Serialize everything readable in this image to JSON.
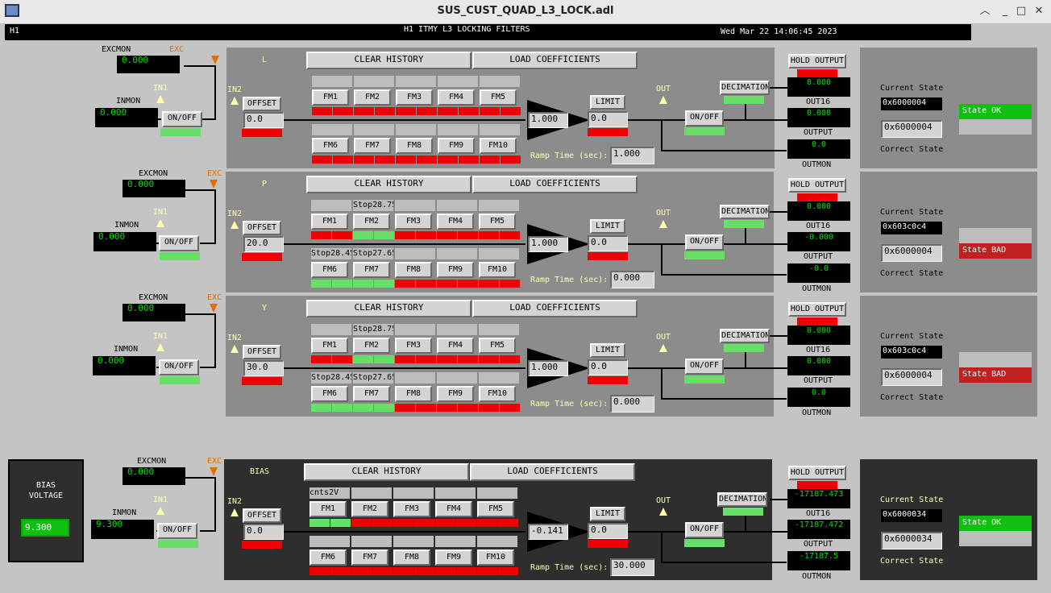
{
  "window": {
    "title": "SUS_CUST_QUAD_L3_LOCK.adl"
  },
  "header": {
    "site": "H1",
    "title": "H1 ITMY L3 LOCKING FILTERS",
    "datetime": "Wed Mar 22 14:06:45 2023"
  },
  "common": {
    "excmon": "EXCMON",
    "exc": "EXC",
    "in1": "IN1",
    "inmon": "INMON",
    "in2": "IN2",
    "onoff": "ON/OFF",
    "offset": "OFFSET",
    "clear_history": "CLEAR HISTORY",
    "load_coefficients": "LOAD COEFFICIENTS",
    "limit": "LIMIT",
    "out": "OUT",
    "ramp_time": "Ramp Time (sec):",
    "hold_output": "HOLD OUTPUT",
    "decimation": "DECIMATION",
    "out16": "OUT16",
    "output": "OUTPUT",
    "outmon": "OUTMON",
    "current_state": "Current State",
    "correct_state": "Correct State",
    "fm_labels": [
      "FM1",
      "FM2",
      "FM3",
      "FM4",
      "FM5",
      "FM6",
      "FM7",
      "FM8",
      "FM9",
      "FM10"
    ]
  },
  "banks": [
    {
      "name": "L",
      "excmon": "0.000",
      "inmon": "0.000",
      "offset": "0.0",
      "gain": "1.000",
      "limit": "0.0",
      "ramp": "1.000",
      "out16": "0.000",
      "output": "0.000",
      "outmon": "0.0",
      "current_state": "0x6000004",
      "correct_state": "0x6000004",
      "state_text": "State OK",
      "state_ok": true,
      "fm_names": [
        "",
        "",
        "",
        "",
        "",
        "",
        "",
        "",
        "",
        ""
      ],
      "fm_on": [
        false,
        false,
        false,
        false,
        false,
        false,
        false,
        false,
        false,
        false
      ]
    },
    {
      "name": "P",
      "excmon": "0.000",
      "inmon": "0.000",
      "offset": "20.0",
      "gain": "1.000",
      "limit": "0.0",
      "ramp": "0.000",
      "out16": "0.000",
      "output": "-0.000",
      "outmon": "-0.0",
      "current_state": "0x603c0c4",
      "correct_state": "0x6000004",
      "state_text": "State BAD",
      "state_ok": false,
      "fm_names": [
        "",
        "Stop28.75",
        "",
        "",
        "",
        "Stop28.45",
        "Stop27.65",
        "",
        "",
        ""
      ],
      "fm_on": [
        false,
        true,
        false,
        false,
        false,
        true,
        true,
        false,
        false,
        false
      ]
    },
    {
      "name": "Y",
      "excmon": "0.000",
      "inmon": "0.000",
      "offset": "30.0",
      "gain": "1.000",
      "limit": "0.0",
      "ramp": "0.000",
      "out16": "0.000",
      "output": "0.000",
      "outmon": "0.0",
      "current_state": "0x603c0c4",
      "correct_state": "0x6000004",
      "state_text": "State BAD",
      "state_ok": false,
      "fm_names": [
        "",
        "Stop28.75",
        "",
        "",
        "",
        "Stop28.45",
        "Stop27.65",
        "",
        "",
        ""
      ],
      "fm_on": [
        false,
        true,
        false,
        false,
        false,
        true,
        true,
        false,
        false,
        false
      ]
    },
    {
      "name": "BIAS",
      "excmon": "0.000",
      "inmon": "9.300",
      "offset": "0.0",
      "gain": "-0.141",
      "limit": "0.0",
      "ramp": "30.000",
      "out16": "-17187.473",
      "output": "-17187.472",
      "outmon": "-17187.5",
      "current_state": "0x6000034",
      "correct_state": "0x6000034",
      "state_text": "State OK",
      "state_ok": true,
      "fm_names": [
        "cnts2V",
        "",
        "",
        "",
        "",
        "",
        "",
        "",
        "",
        ""
      ],
      "fm_on": [
        true,
        false,
        false,
        false,
        false,
        false,
        false,
        false,
        false,
        false
      ]
    }
  ],
  "bias_voltage": {
    "label_line1": "BIAS",
    "label_line2": "VOLTAGE",
    "value": "9.300"
  },
  "colors": {
    "panel": "#8c8c8c",
    "dark_panel": "#2e2e2e",
    "on": "#68e068",
    "off": "#f00000",
    "monitor_text": "#00e000"
  }
}
